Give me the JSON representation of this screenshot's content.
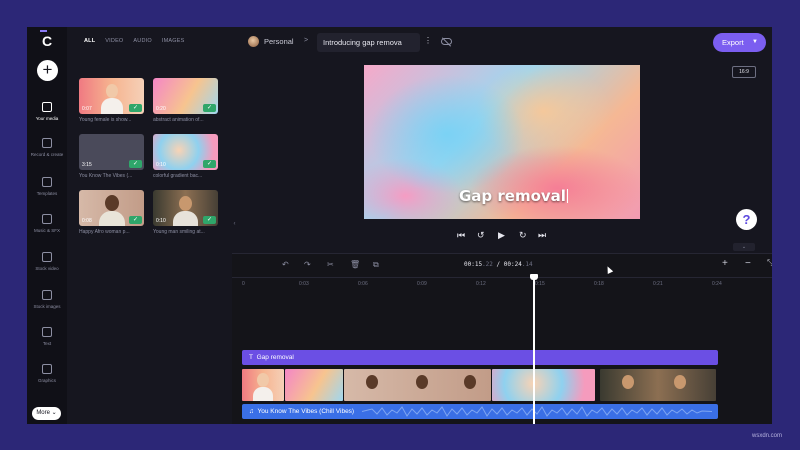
{
  "app": {
    "logo": "C",
    "colors": {
      "accent": "#7b5ef0",
      "text_track": "#6b4fe4",
      "audio_track": "#3a6fe6",
      "check": "#2fa66a"
    }
  },
  "rail": {
    "create_icon": "+",
    "items": [
      {
        "label": "Your media",
        "icon": "folder-icon"
      },
      {
        "label": "Record & create",
        "icon": "camera-icon"
      },
      {
        "label": "Templates",
        "icon": "grid-icon"
      },
      {
        "label": "Music & SFX",
        "icon": "music-note-icon"
      },
      {
        "label": "Stock video",
        "icon": "film-icon"
      },
      {
        "label": "Stock images",
        "icon": "image-icon"
      },
      {
        "label": "Text",
        "icon": "text-t-icon"
      },
      {
        "label": "Graphics",
        "icon": "shapes-icon"
      }
    ],
    "more_label": "More"
  },
  "media": {
    "tabs": [
      "ALL",
      "VIDEO",
      "AUDIO",
      "IMAGES"
    ],
    "items": [
      {
        "duration": "0:07",
        "caption": "Young female is show..."
      },
      {
        "duration": "0:20",
        "caption": "abstract animation of..."
      },
      {
        "duration": "3:15",
        "caption": "You Know The Vibes (..."
      },
      {
        "duration": "0:10",
        "caption": "colorful gradient bac..."
      },
      {
        "duration": "0:08",
        "caption": "Happy Afro woman p..."
      },
      {
        "duration": "0:10",
        "caption": "Young man smiling at..."
      }
    ],
    "check_glyph": "✓"
  },
  "header": {
    "workspace": "Personal",
    "separator": ">",
    "project_title": "Introducing gap remova",
    "menu_glyph": "⋮",
    "export_label": "Export",
    "export_chevron": "▼",
    "aspect_ratio": "16:9"
  },
  "preview": {
    "caption": "Gap removal",
    "controls": {
      "prev": "⏮",
      "back": "↺",
      "play": "▶",
      "forward": "↻",
      "next": "⏭"
    },
    "help": "?",
    "collapse": "⌄"
  },
  "timeline": {
    "tools": {
      "undo": "↶",
      "redo": "↷",
      "cut": "✂",
      "delete": "🗑",
      "duplicate": "⧉"
    },
    "current_time": "00:15",
    "current_frac": ".22",
    "separator": " / ",
    "total_time": "00:24",
    "total_frac": ".14",
    "zoom_in": "+",
    "zoom_out": "−",
    "fit": "⤡",
    "ticks": [
      "0",
      "0:03",
      "0:06",
      "0:09",
      "0:12",
      "0:15",
      "0:18",
      "0:21",
      "0:24"
    ],
    "text_track": {
      "icon": "T",
      "label": "Gap removal"
    },
    "audio_track": {
      "icon": "♫",
      "label": "You Know The Vibes (Chill Vibes)"
    }
  },
  "footer": {
    "watermark": "wsxdn.com"
  }
}
